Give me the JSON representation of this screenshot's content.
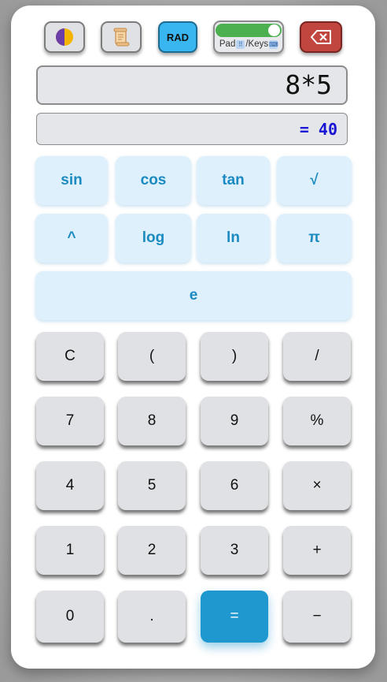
{
  "toolbar": {
    "theme_icon": "half-circle-theme-icon",
    "history_icon": "scroll-icon",
    "angle_mode": "RAD",
    "input_toggle": {
      "label_pad": "Pad",
      "label_keys": "/Keys",
      "pad_glyph": "⠿",
      "keys_glyph": "⌨",
      "enabled": true
    },
    "backspace_icon": "backspace-icon",
    "colors": {
      "rad": "#39b5f0",
      "toggle_on": "#4caf50",
      "backspace": "#c0463f"
    }
  },
  "display": {
    "expression": "8*5",
    "result": "= 40"
  },
  "scientific": {
    "row1": [
      "sin",
      "cos",
      "tan",
      "√"
    ],
    "row2": [
      "^",
      "log",
      "ln",
      "π"
    ],
    "row3": [
      "e"
    ]
  },
  "keypad": {
    "row1": [
      "C",
      "(",
      ")",
      "/"
    ],
    "row2": [
      "7",
      "8",
      "9",
      "%"
    ],
    "row3": [
      "4",
      "5",
      "6",
      "×"
    ],
    "row4": [
      "1",
      "2",
      "3",
      "+"
    ],
    "row5": [
      "0",
      ".",
      "=",
      "−"
    ]
  },
  "colors": {
    "scientific_bg": "#ddf0fc",
    "scientific_text": "#1a8ac0",
    "equals_bg": "#1f97cf",
    "result_text": "#1a14d4"
  }
}
